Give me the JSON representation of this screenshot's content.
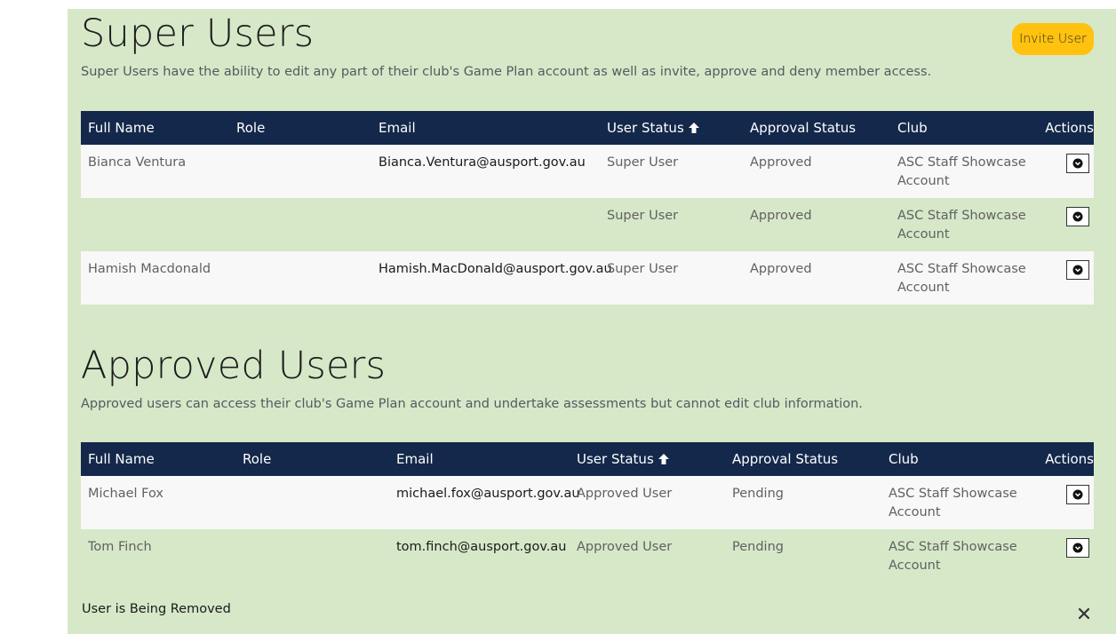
{
  "super_users": {
    "title": "Super Users",
    "description": "Super Users have the ability to edit any part of their club's Game Plan account as well as invite, approve and deny member access.",
    "invite_label": "Invite User",
    "columns": [
      "Full Name",
      "Role",
      "Email",
      "User Status",
      "Approval Status",
      "Club",
      "Actions"
    ],
    "rows": [
      {
        "name": "Bianca Ventura",
        "role": "",
        "email": "Bianca.Ventura@ausport.gov.au",
        "status": "Super User",
        "approval": "Approved",
        "club": "ASC Staff Showcase Account"
      },
      {
        "name": "",
        "role": "",
        "email": "",
        "status": "Super User",
        "approval": "Approved",
        "club": "ASC Staff Showcase Account"
      },
      {
        "name": "Hamish Macdonald",
        "role": "",
        "email": "Hamish.MacDonald@ausport.gov.au",
        "status": "Super User",
        "approval": "Approved",
        "club": "ASC Staff Showcase Account"
      }
    ]
  },
  "approved_users": {
    "title": "Approved Users",
    "description": "Approved users can access their club's Game Plan account and undertake assessments but cannot edit club information.",
    "columns": [
      "Full Name",
      "Role",
      "Email",
      "User Status",
      "Approval Status",
      "Club",
      "Actions"
    ],
    "rows": [
      {
        "name": "Michael Fox",
        "role": "",
        "email": "michael.fox@ausport.gov.au",
        "status": "Approved User",
        "approval": "Pending",
        "club": "ASC Staff Showcase Account"
      },
      {
        "name": "Tom Finch",
        "role": "",
        "email": "tom.finch@ausport.gov.au",
        "status": "Approved User",
        "approval": "Pending",
        "club": "ASC Staff Showcase Account"
      }
    ]
  },
  "notification": {
    "message": "User is Being Removed"
  },
  "icons": {
    "sort": "arrow-up-icon",
    "actions": "chevron-down-circle-icon",
    "close": "close-icon"
  },
  "colors": {
    "panel_bg": "#d6e8c8",
    "header_bg": "#14284b",
    "accent": "#ffc20e"
  }
}
